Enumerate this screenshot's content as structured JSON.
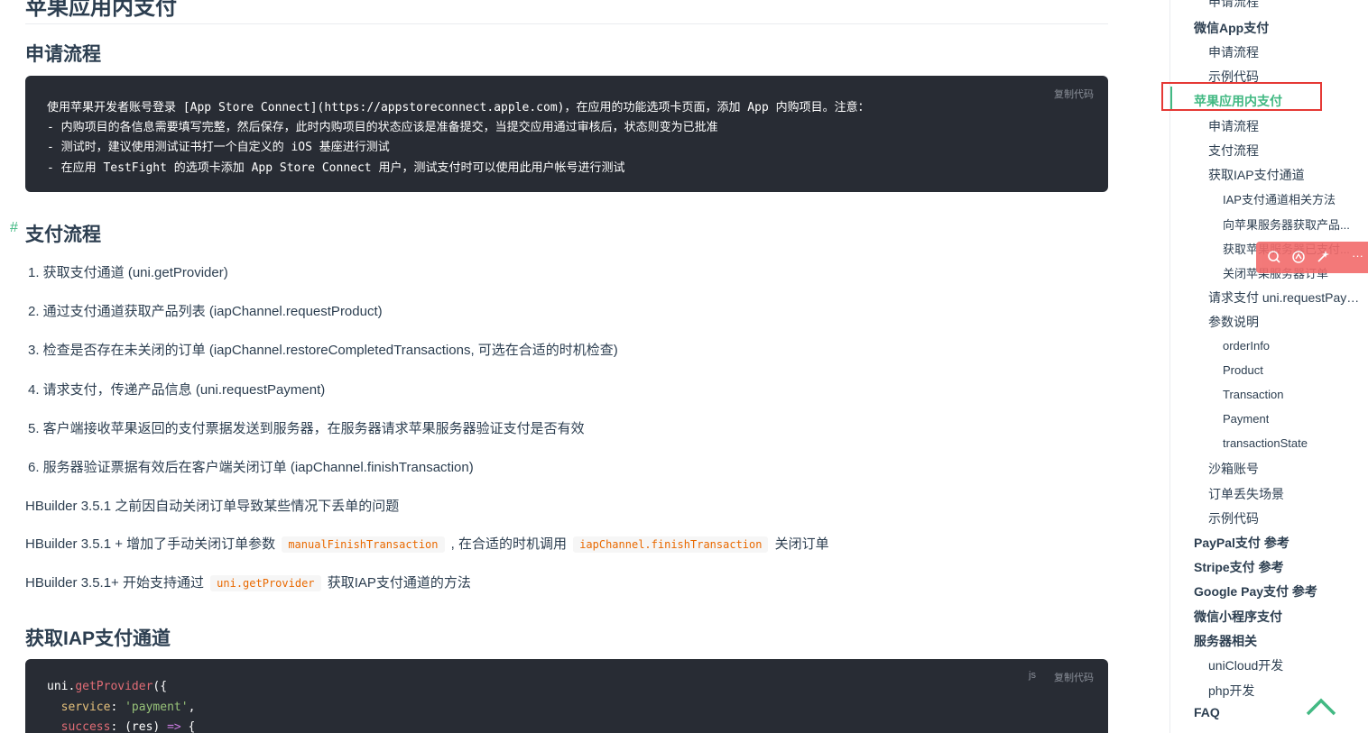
{
  "main": {
    "h1_title": "苹果应用内支付",
    "section_apply": {
      "title": "申请流程",
      "copy_label": "复制代码",
      "lines": [
        "使用苹果开发者账号登录 [App Store Connect](https://appstoreconnect.apple.com)，在应用的功能选项卡页面，添加 App 内购项目。注意：",
        "- 内购项目的各信息需要填写完整，然后保存，此时内购项目的状态应该是准备提交，当提交应用通过审核后，状态则变为已批准",
        "- 测试时，建议使用测试证书打一个自定义的 iOS 基座进行测试",
        "- 在应用 TestFight 的选项卡添加 App Store Connect 用户，测试支付时可以使用此用户帐号进行测试"
      ]
    },
    "section_payflow": {
      "anchor": "#",
      "title": "支付流程",
      "steps": [
        "1. 获取支付通道 (uni.getProvider)",
        "2. 通过支付通道获取产品列表 (iapChannel.requestProduct)",
        "3. 检查是否存在未关闭的订单 (iapChannel.restoreCompletedTransactions, 可选在合适的时机检查)",
        "4. 请求支付，传递产品信息 (uni.requestPayment)",
        "5. 客户端接收苹果返回的支付票据发送到服务器，在服务器请求苹果服务器验证支付是否有效",
        "6. 服务器验证票据有效后在客户端关闭订单 (iapChannel.finishTransaction)"
      ],
      "note1": "HBuilder 3.5.1 之前因自动关闭订单导致某些情况下丢单的问题",
      "note2_pre": "HBuilder 3.5.1 + 增加了手动关闭订单参数",
      "note2_code1": "manualFinishTransaction",
      "note2_mid": ", 在合适的时机调用",
      "note2_code2": "iapChannel.finishTransaction",
      "note2_post": "关闭订单",
      "note3_pre": "HBuilder 3.5.1+ 开始支持通过",
      "note3_code": "uni.getProvider",
      "note3_post": "获取IAP支付通道的方法"
    },
    "section_iap": {
      "title": "获取IAP支付通道",
      "lang": "js",
      "copy_label": "复制代码",
      "code": {
        "l1_obj": "uni",
        "l1_dot": ".",
        "l1_fn": "getProvider",
        "l1_end": "({",
        "l2_key": "service",
        "l2_colon": ": ",
        "l2_str": "'payment'",
        "l2_end": ",",
        "l3_key": "success",
        "l3_colon": ": ",
        "l3_args": "(res) ",
        "l3_arrow": "=>",
        "l3_end": " {"
      }
    }
  },
  "toc": {
    "items": [
      {
        "label": "申请流程",
        "level": 2
      },
      {
        "label": "微信App支付",
        "level": 1
      },
      {
        "label": "申请流程",
        "level": 2
      },
      {
        "label": "示例代码",
        "level": 2
      },
      {
        "label": "苹果应用内支付",
        "level": 1,
        "active": true
      },
      {
        "label": "申请流程",
        "level": 2
      },
      {
        "label": "支付流程",
        "level": 2
      },
      {
        "label": "获取IAP支付通道",
        "level": 2
      },
      {
        "label": "IAP支付通道相关方法",
        "level": 3
      },
      {
        "label": "向苹果服务器获取产品...",
        "level": 3
      },
      {
        "label": "获取苹果服务器已支付...",
        "level": 3
      },
      {
        "label": "关闭苹果服务器订单",
        "level": 3
      },
      {
        "label": "请求支付 uni.requestPaym...",
        "level": 2
      },
      {
        "label": "参数说明",
        "level": 2
      },
      {
        "label": "orderInfo",
        "level": 3
      },
      {
        "label": "Product",
        "level": 3
      },
      {
        "label": "Transaction",
        "level": 3
      },
      {
        "label": "Payment",
        "level": 3
      },
      {
        "label": "transactionState",
        "level": 3
      },
      {
        "label": "沙箱账号",
        "level": 2
      },
      {
        "label": "订单丢失场景",
        "level": 2
      },
      {
        "label": "示例代码",
        "level": 2
      },
      {
        "label": "PayPal支付 参考",
        "level": 1
      },
      {
        "label": "Stripe支付 参考",
        "level": 1
      },
      {
        "label": "Google Pay支付 参考",
        "level": 1
      },
      {
        "label": "微信小程序支付",
        "level": 1
      },
      {
        "label": "服务器相关",
        "level": 1
      },
      {
        "label": "uniCloud开发",
        "level": 2
      },
      {
        "label": "php开发",
        "level": 2
      },
      {
        "label": "FAQ",
        "level": 1
      }
    ]
  },
  "floatbar": {
    "icons": [
      "search-icon",
      "ai-icon",
      "magic-wand-icon",
      "more-icon"
    ],
    "more_glyph": "···"
  },
  "colors": {
    "accent": "#42b983",
    "code_bg": "#282c34",
    "highlight": "#e53935",
    "floatbar": "#f26b6b"
  }
}
